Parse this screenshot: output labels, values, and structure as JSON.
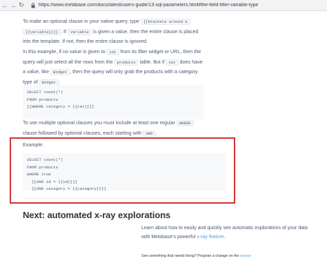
{
  "browser": {
    "url": "https://www.metabase.com/docs/latest/users-guide/13-sql-parameters.html#the-field-filter-variable-type"
  },
  "doc": {
    "p1": {
      "t1": "To make an optional clause in your native query, type",
      "c1": "[[brackets around a",
      "c2": "{{variable}}]]",
      "t2": ". If",
      "c3": "variable",
      "t3": "is given a value, then the entire clause is placed into the template. If not, then the entire clause is ignored."
    },
    "p2": {
      "t1": "In this example, if no value is given to",
      "c1": "cat",
      "t2": "from its filter widget or URL, then the query will just select all the rows from the",
      "c2": "products",
      "t3": "table. But if",
      "c3": "cat",
      "t4": "does have a value, like",
      "c4": "Widget",
      "t5": ", then the query will only grab the products with a category type of",
      "c5": "Widget",
      "t6": "."
    },
    "code1": "SELECT count(*)\nFROM products\n[[WHERE category = {{cat}}]]",
    "p3": {
      "t1": "To use multiple optional clauses you must include at least one regular",
      "c1": "WHERE",
      "t2": "clause followed by optional clauses, each starting with",
      "c2": "AND",
      "t3": "."
    },
    "example_label": "Example:",
    "code2": "SELECT count(*)\nFROM products\nWHERE true\n  [[AND id = {{id}}]]\n  [[AND category = {{category}}]]",
    "next_heading": "Next: automated x-ray explorations",
    "next_text": "Learn about how to easily and quickly see automatic explorations of your data with Metabase's powerful",
    "next_link": "x-ray feature",
    "next_end": ".",
    "footer_text": "See something that needs fixing? Propose a change on the",
    "footer_link": "source"
  },
  "colors": {
    "highlight_border": "#d32f2f",
    "link": "#509ee3",
    "text": "#4c5773",
    "heading": "#2e353b"
  }
}
